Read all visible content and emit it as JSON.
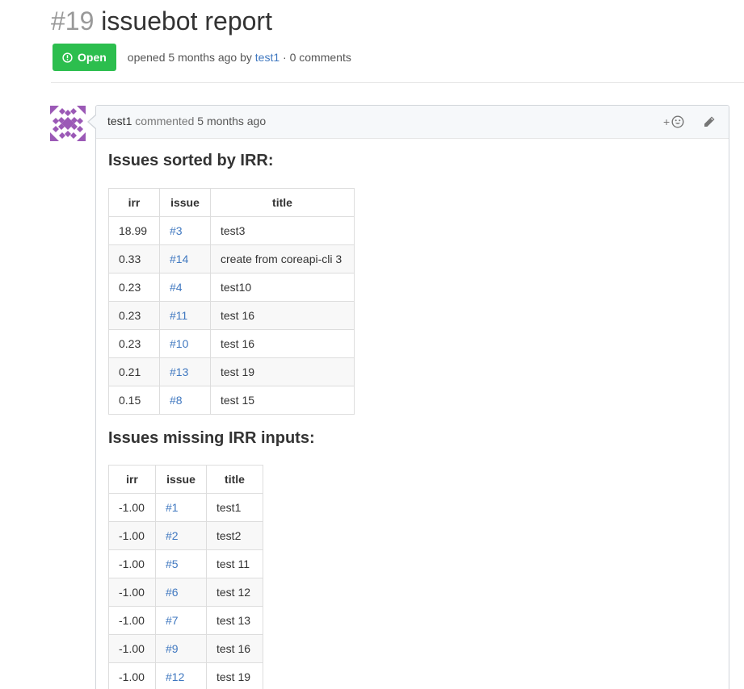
{
  "issue": {
    "number": "#19",
    "title": "issuebot report",
    "state": "Open",
    "meta_opened": "opened 5 months ago by",
    "meta_author": "test1",
    "meta_comments": "· 0 comments"
  },
  "colors": {
    "open_badge": "#2cbe4e",
    "link": "#4078c0"
  },
  "icons": {
    "state": "issue-opened-icon",
    "reaction": "smiley-icon",
    "edit": "pencil-icon",
    "avatar": "identicon-avatar"
  },
  "comment": {
    "author": "test1",
    "verb": "commented",
    "time": "5 months ago",
    "reaction_plus": "+",
    "heading_sorted": "Issues sorted by IRR:",
    "heading_missing": "Issues missing IRR inputs:",
    "sorted_table": {
      "headers": [
        "irr",
        "issue",
        "title"
      ],
      "rows": [
        [
          "18.99",
          "#3",
          "test3"
        ],
        [
          "0.33",
          "#14",
          "create from coreapi-cli 3"
        ],
        [
          "0.23",
          "#4",
          "test10"
        ],
        [
          "0.23",
          "#11",
          "test 16"
        ],
        [
          "0.23",
          "#10",
          "test 16"
        ],
        [
          "0.21",
          "#13",
          "test 19"
        ],
        [
          "0.15",
          "#8",
          "test 15"
        ]
      ]
    },
    "missing_table": {
      "headers": [
        "irr",
        "issue",
        "title"
      ],
      "rows": [
        [
          "-1.00",
          "#1",
          "test1"
        ],
        [
          "-1.00",
          "#2",
          "test2"
        ],
        [
          "-1.00",
          "#5",
          "test 11"
        ],
        [
          "-1.00",
          "#6",
          "test 12"
        ],
        [
          "-1.00",
          "#7",
          "test 13"
        ],
        [
          "-1.00",
          "#9",
          "test 16"
        ],
        [
          "-1.00",
          "#12",
          "test 19"
        ]
      ]
    }
  }
}
